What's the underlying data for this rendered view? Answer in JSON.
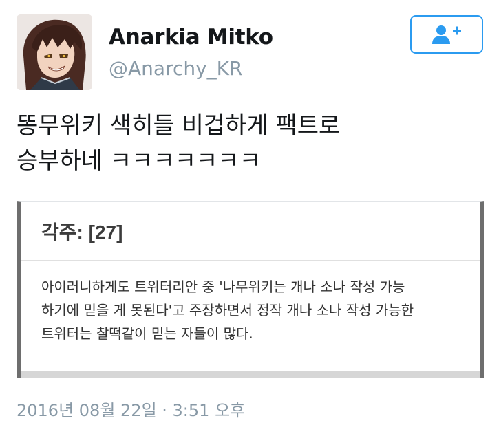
{
  "profile": {
    "display_name": "Anarkia Mitko",
    "handle": "@Anarchy_KR",
    "avatar_icon": "anime-character-avatar"
  },
  "follow_button": {
    "icon": "add-user-icon",
    "color": "#2b9bf0"
  },
  "tweet": {
    "lines": [
      "똥무위키 색히들 비겁하게 팩트로",
      "승부하네 ㅋㅋㅋㅋㅋㅋㅋ"
    ]
  },
  "card": {
    "title": "각주: [27]",
    "body_lines": [
      "아이러니하게도 트위터리안 중 '나무위키는 개나 소나 작성 가능",
      "하기에 믿을 게 못된다'고 주장하면서 정작 개나 소나 작성 가능한",
      "트위터는 찰떡같이 믿는 자들이 많다."
    ]
  },
  "timestamp": "2016년 08월 22일 · 3:51 오후"
}
